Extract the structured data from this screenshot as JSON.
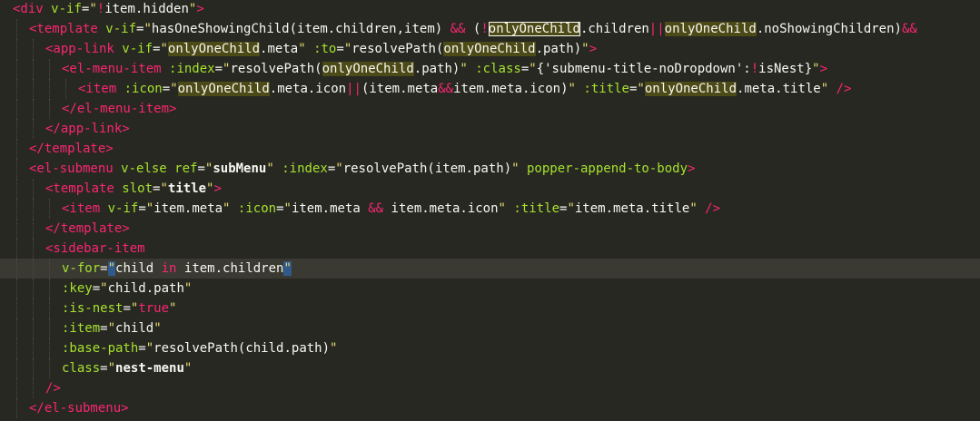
{
  "editor": {
    "language": "vue",
    "current_line": 13,
    "colors": {
      "background": "#272822",
      "tag": "#f92672",
      "attribute": "#a6e22e",
      "string": "#e6db74",
      "plain": "#f8f8f2",
      "word_highlight": "#4c4a16",
      "selection": "#2f5a8a"
    },
    "lines": [
      {
        "indent": 0,
        "tokens": [
          {
            "t": "<div",
            "c": "tag"
          },
          {
            "t": " ",
            "c": "plain"
          },
          {
            "t": "v-if",
            "c": "attr"
          },
          {
            "t": "=",
            "c": "plain"
          },
          {
            "t": "\"",
            "c": "str"
          },
          {
            "t": "!",
            "c": "op"
          },
          {
            "t": "item.hidden",
            "c": "plain"
          },
          {
            "t": "\"",
            "c": "str"
          },
          {
            "t": ">",
            "c": "tag"
          }
        ]
      },
      {
        "indent": 1,
        "tokens": [
          {
            "t": "<template",
            "c": "tag"
          },
          {
            "t": " ",
            "c": "plain"
          },
          {
            "t": "v-if",
            "c": "attr"
          },
          {
            "t": "=",
            "c": "plain"
          },
          {
            "t": "\"",
            "c": "str"
          },
          {
            "t": "hasOneShowingChild(item.children,item) ",
            "c": "plain"
          },
          {
            "t": "&&",
            "c": "op"
          },
          {
            "t": " (",
            "c": "plain"
          },
          {
            "t": "!",
            "c": "op"
          },
          {
            "t": "onlyOneChild",
            "c": "plain",
            "box": true
          },
          {
            "t": ".children",
            "c": "plain"
          },
          {
            "t": "||",
            "c": "op"
          },
          {
            "t": "onlyOneChild",
            "c": "plain",
            "hl": true
          },
          {
            "t": ".noShowingChildren)",
            "c": "plain"
          },
          {
            "t": "&&",
            "c": "op"
          }
        ]
      },
      {
        "indent": 2,
        "tokens": [
          {
            "t": "<app-link",
            "c": "tag"
          },
          {
            "t": " ",
            "c": "plain"
          },
          {
            "t": "v-if",
            "c": "attr"
          },
          {
            "t": "=",
            "c": "plain"
          },
          {
            "t": "\"",
            "c": "str"
          },
          {
            "t": "onlyOneChild",
            "c": "plain",
            "hl": true
          },
          {
            "t": ".meta",
            "c": "plain"
          },
          {
            "t": "\"",
            "c": "str"
          },
          {
            "t": " ",
            "c": "plain"
          },
          {
            "t": ":to",
            "c": "attr"
          },
          {
            "t": "=",
            "c": "plain"
          },
          {
            "t": "\"",
            "c": "str"
          },
          {
            "t": "resolvePath(",
            "c": "plain"
          },
          {
            "t": "onlyOneChild",
            "c": "plain",
            "hl": true
          },
          {
            "t": ".path)",
            "c": "plain"
          },
          {
            "t": "\"",
            "c": "str"
          },
          {
            "t": ">",
            "c": "tag"
          }
        ]
      },
      {
        "indent": 3,
        "tokens": [
          {
            "t": "<el-menu-item",
            "c": "tag"
          },
          {
            "t": " ",
            "c": "plain"
          },
          {
            "t": ":index",
            "c": "attr"
          },
          {
            "t": "=",
            "c": "plain"
          },
          {
            "t": "\"",
            "c": "str"
          },
          {
            "t": "resolvePath(",
            "c": "plain"
          },
          {
            "t": "onlyOneChild",
            "c": "plain",
            "hl": true
          },
          {
            "t": ".path)",
            "c": "plain"
          },
          {
            "t": "\"",
            "c": "str"
          },
          {
            "t": " ",
            "c": "plain"
          },
          {
            "t": ":class",
            "c": "attr"
          },
          {
            "t": "=",
            "c": "plain"
          },
          {
            "t": "\"",
            "c": "str"
          },
          {
            "t": "{'submenu-title-noDropdown':",
            "c": "plain"
          },
          {
            "t": "!",
            "c": "op"
          },
          {
            "t": "isNest}",
            "c": "plain"
          },
          {
            "t": "\"",
            "c": "str"
          },
          {
            "t": ">",
            "c": "tag"
          }
        ]
      },
      {
        "indent": 4,
        "tokens": [
          {
            "t": "<item",
            "c": "tag"
          },
          {
            "t": " ",
            "c": "plain"
          },
          {
            "t": ":icon",
            "c": "attr"
          },
          {
            "t": "=",
            "c": "plain"
          },
          {
            "t": "\"",
            "c": "str"
          },
          {
            "t": "onlyOneChild",
            "c": "plain",
            "hl": true
          },
          {
            "t": ".meta.icon",
            "c": "plain"
          },
          {
            "t": "||",
            "c": "op"
          },
          {
            "t": "(item.meta",
            "c": "plain"
          },
          {
            "t": "&&",
            "c": "op"
          },
          {
            "t": "item.meta.icon)",
            "c": "plain"
          },
          {
            "t": "\"",
            "c": "str"
          },
          {
            "t": " ",
            "c": "plain"
          },
          {
            "t": ":title",
            "c": "attr"
          },
          {
            "t": "=",
            "c": "plain"
          },
          {
            "t": "\"",
            "c": "str"
          },
          {
            "t": "onlyOneChild",
            "c": "plain",
            "hl": true
          },
          {
            "t": ".meta.title",
            "c": "plain"
          },
          {
            "t": "\"",
            "c": "str"
          },
          {
            "t": " />",
            "c": "tag"
          }
        ]
      },
      {
        "indent": 3,
        "tokens": [
          {
            "t": "</el-menu-item>",
            "c": "tag"
          }
        ]
      },
      {
        "indent": 2,
        "tokens": [
          {
            "t": "</app-link>",
            "c": "tag"
          }
        ]
      },
      {
        "indent": 1,
        "tokens": [
          {
            "t": "</template>",
            "c": "tag"
          }
        ]
      },
      {
        "indent": 1,
        "tokens": [
          {
            "t": "<el-submenu",
            "c": "tag"
          },
          {
            "t": " ",
            "c": "plain"
          },
          {
            "t": "v-else",
            "c": "attr"
          },
          {
            "t": " ",
            "c": "plain"
          },
          {
            "t": "ref",
            "c": "attr"
          },
          {
            "t": "=",
            "c": "plain"
          },
          {
            "t": "\"",
            "c": "str"
          },
          {
            "t": "subMenu",
            "c": "plain",
            "bold": true
          },
          {
            "t": "\"",
            "c": "str"
          },
          {
            "t": " ",
            "c": "plain"
          },
          {
            "t": ":index",
            "c": "attr"
          },
          {
            "t": "=",
            "c": "plain"
          },
          {
            "t": "\"",
            "c": "str"
          },
          {
            "t": "resolvePath(item.path)",
            "c": "plain"
          },
          {
            "t": "\"",
            "c": "str"
          },
          {
            "t": " ",
            "c": "plain"
          },
          {
            "t": "popper-append-to-body",
            "c": "attr"
          },
          {
            "t": ">",
            "c": "tag"
          }
        ]
      },
      {
        "indent": 2,
        "tokens": [
          {
            "t": "<template",
            "c": "tag"
          },
          {
            "t": " ",
            "c": "plain"
          },
          {
            "t": "slot",
            "c": "attr"
          },
          {
            "t": "=",
            "c": "plain"
          },
          {
            "t": "\"",
            "c": "str"
          },
          {
            "t": "title",
            "c": "plain",
            "bold": true
          },
          {
            "t": "\"",
            "c": "str"
          },
          {
            "t": ">",
            "c": "tag"
          }
        ]
      },
      {
        "indent": 3,
        "tokens": [
          {
            "t": "<item",
            "c": "tag"
          },
          {
            "t": " ",
            "c": "plain"
          },
          {
            "t": "v-if",
            "c": "attr"
          },
          {
            "t": "=",
            "c": "plain"
          },
          {
            "t": "\"",
            "c": "str"
          },
          {
            "t": "item.meta",
            "c": "plain"
          },
          {
            "t": "\"",
            "c": "str"
          },
          {
            "t": " ",
            "c": "plain"
          },
          {
            "t": ":icon",
            "c": "attr"
          },
          {
            "t": "=",
            "c": "plain"
          },
          {
            "t": "\"",
            "c": "str"
          },
          {
            "t": "item.meta ",
            "c": "plain"
          },
          {
            "t": "&&",
            "c": "op"
          },
          {
            "t": " item.meta.icon",
            "c": "plain"
          },
          {
            "t": "\"",
            "c": "str"
          },
          {
            "t": " ",
            "c": "plain"
          },
          {
            "t": ":title",
            "c": "attr"
          },
          {
            "t": "=",
            "c": "plain"
          },
          {
            "t": "\"",
            "c": "str"
          },
          {
            "t": "item.meta.title",
            "c": "plain"
          },
          {
            "t": "\"",
            "c": "str"
          },
          {
            "t": " />",
            "c": "tag"
          }
        ]
      },
      {
        "indent": 2,
        "tokens": [
          {
            "t": "</template>",
            "c": "tag"
          }
        ]
      },
      {
        "indent": 2,
        "tokens": [
          {
            "t": "<sidebar-item",
            "c": "tag"
          }
        ]
      },
      {
        "indent": 3,
        "tokens": [
          {
            "t": "v-for",
            "c": "attr"
          },
          {
            "t": "=",
            "c": "plain"
          },
          {
            "t": "\"",
            "c": "str",
            "sel": true
          },
          {
            "t": "child ",
            "c": "plain"
          },
          {
            "t": "in",
            "c": "op"
          },
          {
            "t": " item.children",
            "c": "plain"
          },
          {
            "t": "\"",
            "c": "str",
            "sel": true
          }
        ]
      },
      {
        "indent": 3,
        "tokens": [
          {
            "t": ":key",
            "c": "attr"
          },
          {
            "t": "=",
            "c": "plain"
          },
          {
            "t": "\"",
            "c": "str"
          },
          {
            "t": "child.path",
            "c": "plain"
          },
          {
            "t": "\"",
            "c": "str"
          }
        ]
      },
      {
        "indent": 3,
        "tokens": [
          {
            "t": ":is-nest",
            "c": "attr"
          },
          {
            "t": "=",
            "c": "plain"
          },
          {
            "t": "\"",
            "c": "str"
          },
          {
            "t": "true",
            "c": "op"
          },
          {
            "t": "\"",
            "c": "str"
          }
        ]
      },
      {
        "indent": 3,
        "tokens": [
          {
            "t": ":item",
            "c": "attr"
          },
          {
            "t": "=",
            "c": "plain"
          },
          {
            "t": "\"",
            "c": "str"
          },
          {
            "t": "child",
            "c": "plain"
          },
          {
            "t": "\"",
            "c": "str"
          }
        ]
      },
      {
        "indent": 3,
        "tokens": [
          {
            "t": ":base-path",
            "c": "attr"
          },
          {
            "t": "=",
            "c": "plain"
          },
          {
            "t": "\"",
            "c": "str"
          },
          {
            "t": "resolvePath(child.path)",
            "c": "plain"
          },
          {
            "t": "\"",
            "c": "str"
          }
        ]
      },
      {
        "indent": 3,
        "tokens": [
          {
            "t": "class",
            "c": "attr"
          },
          {
            "t": "=",
            "c": "plain"
          },
          {
            "t": "\"",
            "c": "str"
          },
          {
            "t": "nest-menu",
            "c": "plain",
            "bold": true
          },
          {
            "t": "\"",
            "c": "str"
          }
        ]
      },
      {
        "indent": 2,
        "tokens": [
          {
            "t": "/>",
            "c": "tag"
          }
        ]
      },
      {
        "indent": 1,
        "tokens": [
          {
            "t": "</el-submenu>",
            "c": "tag"
          }
        ]
      }
    ]
  }
}
